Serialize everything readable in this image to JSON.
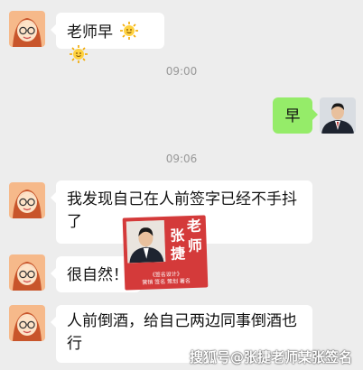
{
  "messages": [
    {
      "side": "left",
      "text": "老师早"
    },
    {
      "side": "right",
      "text": "早"
    },
    {
      "side": "left",
      "text_line1": "我发现自己在人前签字已经不手抖",
      "text_line2": "了"
    },
    {
      "side": "left",
      "text": "很自然！"
    },
    {
      "side": "left",
      "text_line1": "人前倒酒，给自己两边同事倒酒也",
      "text_line2": "行"
    }
  ],
  "timestamps": [
    "09:00",
    "09:06"
  ],
  "seal": {
    "chars": [
      "张",
      "捷",
      "老",
      "师"
    ],
    "caption_line1": "《签名设计》",
    "caption_line2": "营销 签名 策划 著名"
  },
  "watermark": "搜狐号@张捷老师某张签名",
  "colors": {
    "background": "#ededed",
    "bubble_left": "#ffffff",
    "bubble_right": "#95ec69",
    "seal": "#d43a3a"
  }
}
